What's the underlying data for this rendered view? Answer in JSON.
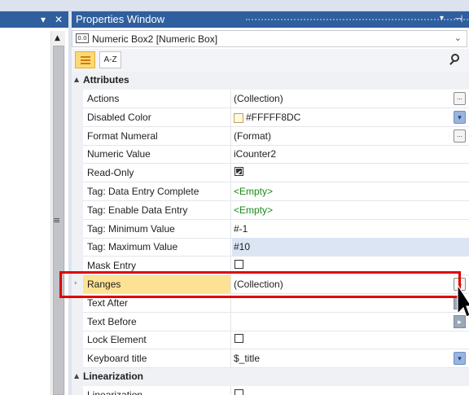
{
  "left_panel": {
    "controls": {
      "dropdown_glyph": "▾",
      "close_glyph": "✕"
    }
  },
  "properties_window": {
    "title": "Properties Window",
    "title_controls": {
      "dropdown_glyph": "▾",
      "pin_glyph": "⊣"
    },
    "object_selector": {
      "value": "Numeric Box2 [Numeric Box]",
      "icon": "numeric-box-icon",
      "icon_text": "0.0"
    },
    "toolbar": {
      "categorized_icon": "categorized-icon",
      "alphabetical_label": "A-Z",
      "search_icon": "search-icon"
    }
  },
  "categories": [
    {
      "label": "Attributes",
      "properties": [
        {
          "name": "Actions",
          "value": "(Collection)",
          "button": "ellipsis"
        },
        {
          "name": "Disabled Color",
          "value": "#FFFFF8DC",
          "swatch": "#FFF8DC",
          "button": "dropdown"
        },
        {
          "name": "Format Numeral",
          "value": "(Format)",
          "button": "ellipsis"
        },
        {
          "name": "Numeric Value",
          "value": "iCounter2"
        },
        {
          "name": "Read-Only",
          "checkbox": true,
          "checked": true
        },
        {
          "name": "Tag: Data Entry Complete",
          "value": "<Empty>",
          "style": "green"
        },
        {
          "name": "Tag: Enable Data Entry",
          "value": "<Empty>",
          "style": "green"
        },
        {
          "name": "Tag: Minimum Value",
          "value": "#-1"
        },
        {
          "name": "Tag: Maximum Value",
          "value": "#10",
          "style": "blue"
        },
        {
          "name": "Mask Entry",
          "checkbox": true,
          "checked": false
        },
        {
          "name": "Ranges",
          "value": "(Collection)",
          "selected": true,
          "button": "ellipsis"
        },
        {
          "name": "Text After",
          "value": "",
          "button": "side"
        },
        {
          "name": "Text Before",
          "value": "",
          "button": "side"
        },
        {
          "name": "Lock Element",
          "checkbox": true,
          "checked": false
        },
        {
          "name": "Keyboard title",
          "value": "$_title",
          "button": "dropdown"
        }
      ]
    },
    {
      "label": "Linearization",
      "properties": [
        {
          "name": "Linearization",
          "checkbox": true,
          "checked": false
        }
      ]
    }
  ],
  "colors": {
    "title_bar": "#2f5f9e",
    "selected_row": "#fde295",
    "highlight_border": "#e10000",
    "empty_text": "#1a8a1a",
    "active_value_bg": "#dbe5f4"
  }
}
